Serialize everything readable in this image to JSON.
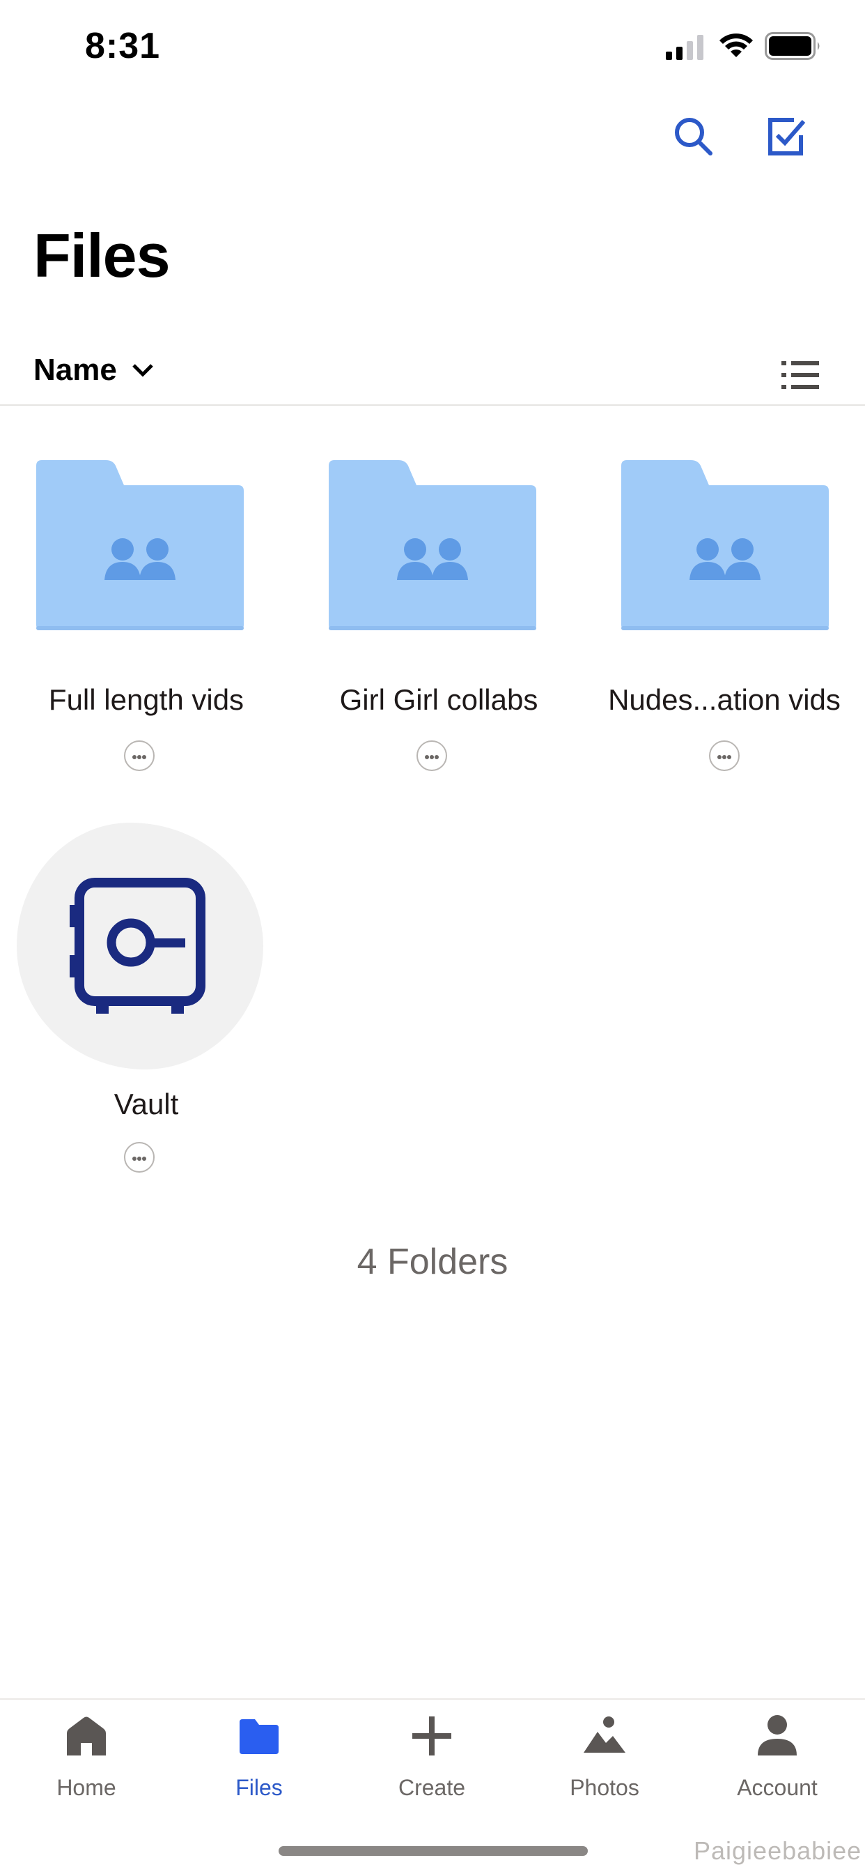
{
  "status_bar": {
    "time": "8:31"
  },
  "header": {
    "title": "Files"
  },
  "toolbar": {
    "sort_label": "Name"
  },
  "folders": [
    {
      "name": "Full length vids",
      "type": "shared-folder"
    },
    {
      "name": "Girl Girl collabs",
      "type": "shared-folder"
    },
    {
      "name": "Nudes...ation vids",
      "type": "shared-folder"
    },
    {
      "name": "Vault",
      "type": "vault"
    }
  ],
  "footer": {
    "count": "4 Folders"
  },
  "tabs": [
    {
      "label": "Home",
      "icon": "home-icon",
      "active": false
    },
    {
      "label": "Files",
      "icon": "folder-icon",
      "active": true
    },
    {
      "label": "Create",
      "icon": "plus-icon",
      "active": false
    },
    {
      "label": "Photos",
      "icon": "photos-icon",
      "active": false
    },
    {
      "label": "Account",
      "icon": "person-icon",
      "active": false
    }
  ],
  "watermark": "Paigieebabiee",
  "colors": {
    "accent": "#2c59c8",
    "folder": "#a0cbf8",
    "folder_people": "#5f9be5",
    "vault_icon": "#1a2a80",
    "active_tab_icon": "#2a5ef0"
  }
}
